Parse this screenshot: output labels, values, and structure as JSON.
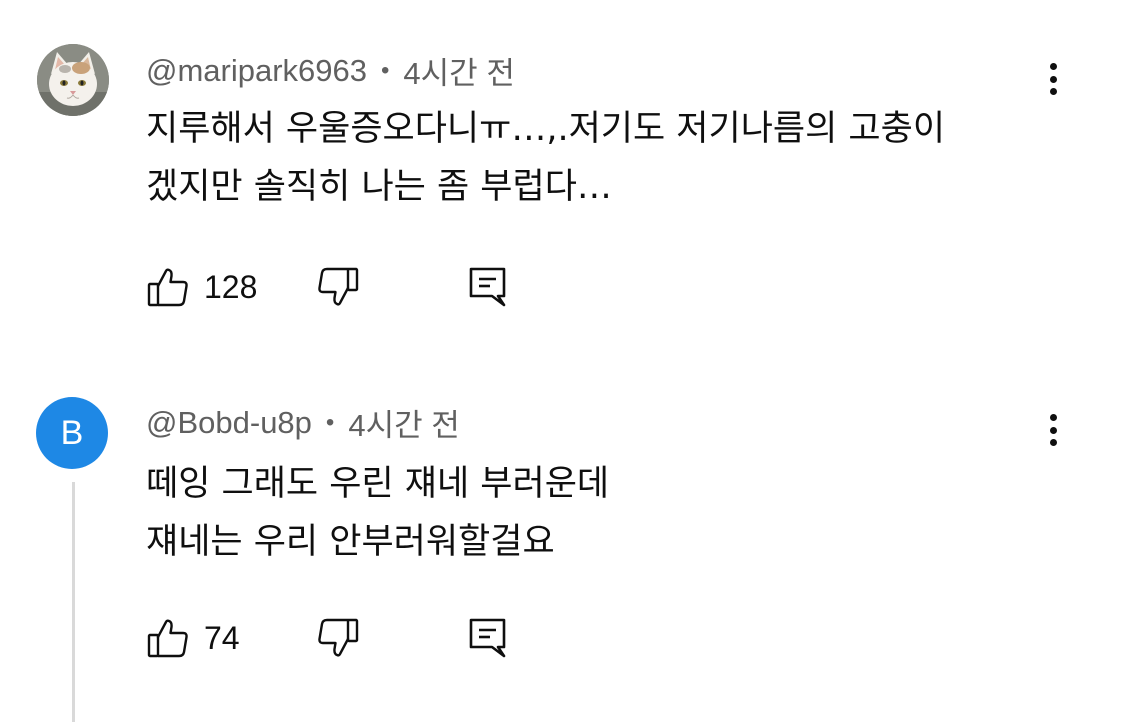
{
  "comments": [
    {
      "author": "@maripark6963",
      "time": "4시간 전",
      "lines": [
        "지루해서 우울증오다니ㅠ…,.저기도 저기나름의 고충이",
        "겠지만 솔직히 나는 좀 부럽다…"
      ],
      "likes": "128",
      "avatar": "cat-avatar"
    },
    {
      "author": "@Bobd-u8p",
      "time": "4시간 전",
      "lines": [
        "떼잉 그래도 우린 쟤네 부러운데",
        "쟤네는 우리 안부러워할걸요"
      ],
      "likes": "74",
      "avatar_letter": "B",
      "avatar_color": "#1e88e5"
    }
  ],
  "meta_separator": "•"
}
